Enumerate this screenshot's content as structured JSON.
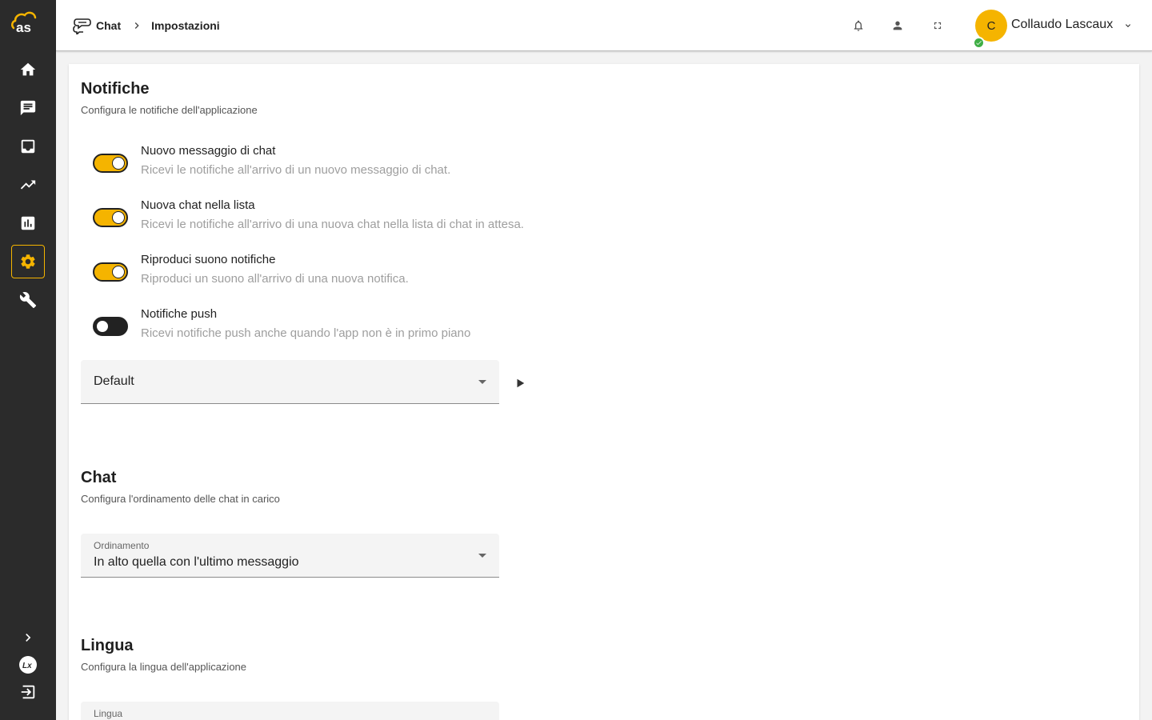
{
  "app": {
    "accent_color": "#f5b400",
    "sidebar_color": "#2b2b2b"
  },
  "sidebar": {
    "items": [
      {
        "icon": "home-icon",
        "active": false
      },
      {
        "icon": "chat-icon",
        "active": false
      },
      {
        "icon": "inbox-icon",
        "active": false
      },
      {
        "icon": "trending-icon",
        "active": false
      },
      {
        "icon": "bar-chart-icon",
        "active": false
      },
      {
        "icon": "gear-icon",
        "active": true
      },
      {
        "icon": "wrench-icon",
        "active": false
      }
    ],
    "bottom": [
      "chevron-right-icon",
      "lx-logo-icon",
      "logout-icon"
    ]
  },
  "header": {
    "breadcrumb": [
      "Chat",
      "Impostazioni"
    ],
    "icons": [
      "bell-icon",
      "person-icon",
      "fullscreen-icon"
    ],
    "user_initial": "C",
    "user_name": "Collaudo Lascaux",
    "status": "online"
  },
  "notifiche": {
    "title": "Notifiche",
    "subtitle": "Configura le notifiche dell'applicazione",
    "toggles": [
      {
        "title": "Nuovo messaggio di chat",
        "desc": "Ricevi le notifiche all'arrivo di un nuovo messaggio di chat.",
        "on": true
      },
      {
        "title": "Nuova chat nella lista",
        "desc": "Ricevi le notifiche all'arrivo di una nuova chat nella lista di chat in attesa.",
        "on": true
      },
      {
        "title": "Riproduci suono notifiche",
        "desc": "Riproduci un suono all'arrivo di una nuova notifica.",
        "on": true
      },
      {
        "title": "Notifiche push",
        "desc": "Ricevi notifiche push anche quando l'app non è in primo piano",
        "on": false
      }
    ],
    "sound_select": "Default"
  },
  "chat": {
    "title": "Chat",
    "subtitle": "Configura l'ordinamento delle chat in carico",
    "sort_label": "Ordinamento",
    "sort_value": "In alto quella con l'ultimo messaggio"
  },
  "lingua": {
    "title": "Lingua",
    "subtitle": "Configura la lingua dell'applicazione",
    "field_label": "Lingua"
  }
}
